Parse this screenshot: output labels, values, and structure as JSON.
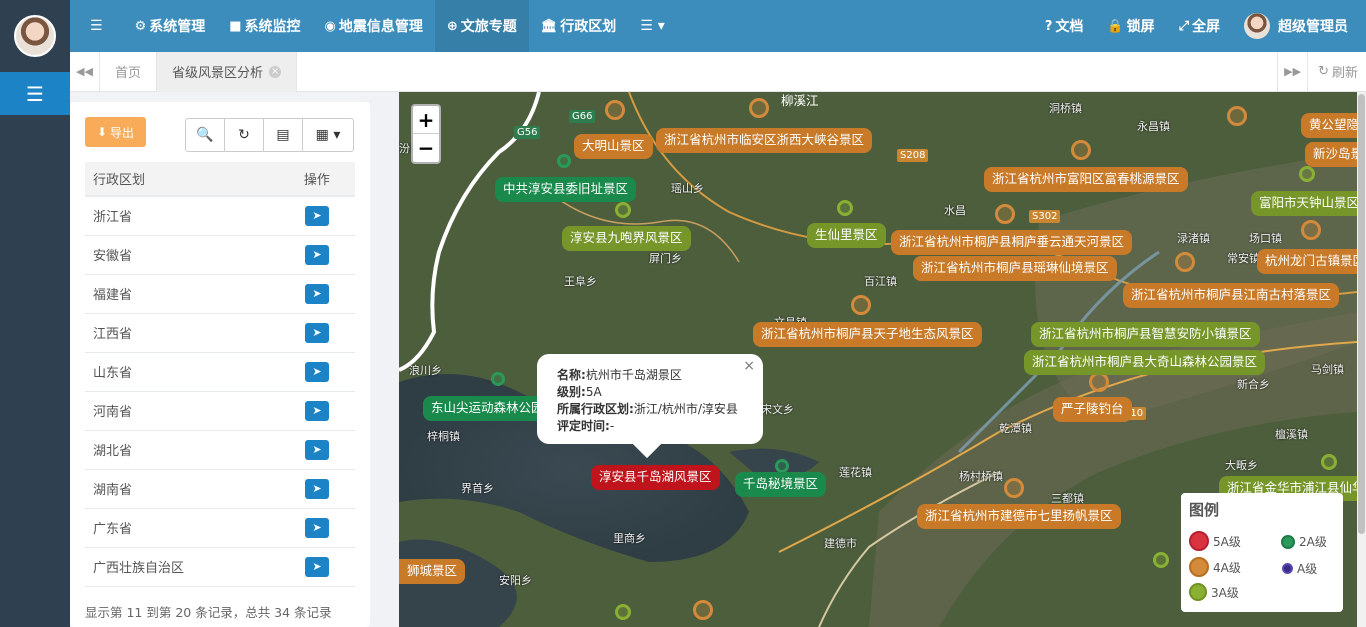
{
  "topnav": {
    "items": [
      {
        "icon": "gear-icon",
        "glyph": "⚙",
        "label": "系统管理"
      },
      {
        "icon": "video-camera-icon",
        "glyph": "■",
        "label": "系统监控"
      },
      {
        "icon": "map-marker-icon",
        "glyph": "◉",
        "label": "地震信息管理"
      },
      {
        "icon": "globe-icon",
        "glyph": "⊕",
        "label": "文旅专题"
      },
      {
        "icon": "bank-icon",
        "glyph": "🏛",
        "label": "行政区划"
      }
    ],
    "more_glyph": "☰ ▾",
    "menu_glyph": "☰",
    "right": {
      "docs": "文档",
      "lock": "锁屏",
      "fullscreen": "全屏",
      "user": "超级管理员"
    }
  },
  "tabs": {
    "home": "首页",
    "active": "省级风景区分析",
    "refresh": "刷新"
  },
  "toolbar": {
    "export": "导出"
  },
  "table": {
    "headers": [
      "行政区划",
      "操作"
    ],
    "rows": [
      "浙江省",
      "安徽省",
      "福建省",
      "江西省",
      "山东省",
      "河南省",
      "湖北省",
      "湖南省",
      "广东省",
      "广西壮族自治区"
    ]
  },
  "pagination": {
    "info": "显示第 11 到第 20 条记录，总共 34 条记录"
  },
  "map": {
    "zoom_in": "+",
    "zoom_out": "−",
    "popup": {
      "name_label": "名称:",
      "name_value": "杭州市千岛湖景区",
      "level_label": "级别:",
      "level_value": "5A",
      "region_label": "所属行政区划:",
      "region_value": "浙江/杭州市/淳安县",
      "date_label": "评定时间:",
      "date_value": "-",
      "close": "×"
    },
    "legend": {
      "title": "图例",
      "items": [
        "5A级",
        "2A级",
        "4A级",
        "A级",
        "3A级"
      ],
      "colors": {
        "5A级": "#d9333f",
        "2A级": "#2a9a5a",
        "4A级": "#d38a3a",
        "A级": "#3b2a8a",
        "3A级": "#8ab033"
      }
    },
    "labels": {
      "l1": "柳溪江",
      "l2": "大明山景区",
      "l3": "浙江省杭州市临安区浙西大峡谷景区",
      "l4": "中共淳安县委旧址景区",
      "l5": "淳安县九咆界风景区",
      "l6": "生仙里景区",
      "l7": "浙江省杭州市富阳区富春桃源景区",
      "l8": "浙江省杭州市桐庐县桐庐垂云通天河景区",
      "l9": "浙江省杭州市桐庐县瑶琳仙境景区",
      "l10": "浙江省杭州市桐庐县天子地生态风景区",
      "l11": "浙江省杭州市桐庐县江南古村落景区",
      "l12": "浙江省杭州市桐庐县智慧安防小镇景区",
      "l13": "浙江省杭州市桐庐县大奇山森林公园景区",
      "l14": "严子陵钓台",
      "l15": "东山尖运动森林公园",
      "l16": "淳安县千岛湖风景区",
      "l17": "千岛秘境景区",
      "l18": "浙江省杭州市建德市七里扬帆景区",
      "l19": "富阳市天钟山景区",
      "l20": "杭州龙门古镇景区",
      "l21": "黄公望隐",
      "l22": "新沙岛景",
      "l23": "浙江省金华市浦江县仙华",
      "l24": "狮城景区"
    },
    "places": {
      "p1": "洞桥镇",
      "p2": "永昌镇",
      "p3": "瑶山乡",
      "p4": "王阜乡",
      "p5": "屏门乡",
      "p6": "百江镇",
      "p7": "汾口镇",
      "p8": "浪川乡",
      "p9": "界首乡",
      "p10": "建德市",
      "p11": "安阳乡",
      "p12": "里商乡",
      "p13": "莲花镇",
      "p14": "杨村桥镇",
      "p15": "乾潭镇",
      "p16": "三都镇",
      "p17": "大畈乡",
      "p18": "檀溪镇",
      "p19": "新合乡",
      "p20": "马剑镇",
      "p21": "文昌镇",
      "p22": "宋文乡",
      "p23": "场口镇",
      "p24": "梓桐镇",
      "p25": "水昌",
      "p26": "常安镇",
      "p27": "渌渚镇"
    },
    "roads": {
      "r1": "G56",
      "r2": "G66",
      "r3": "S208",
      "r4": "S302",
      "r5": "210"
    }
  }
}
